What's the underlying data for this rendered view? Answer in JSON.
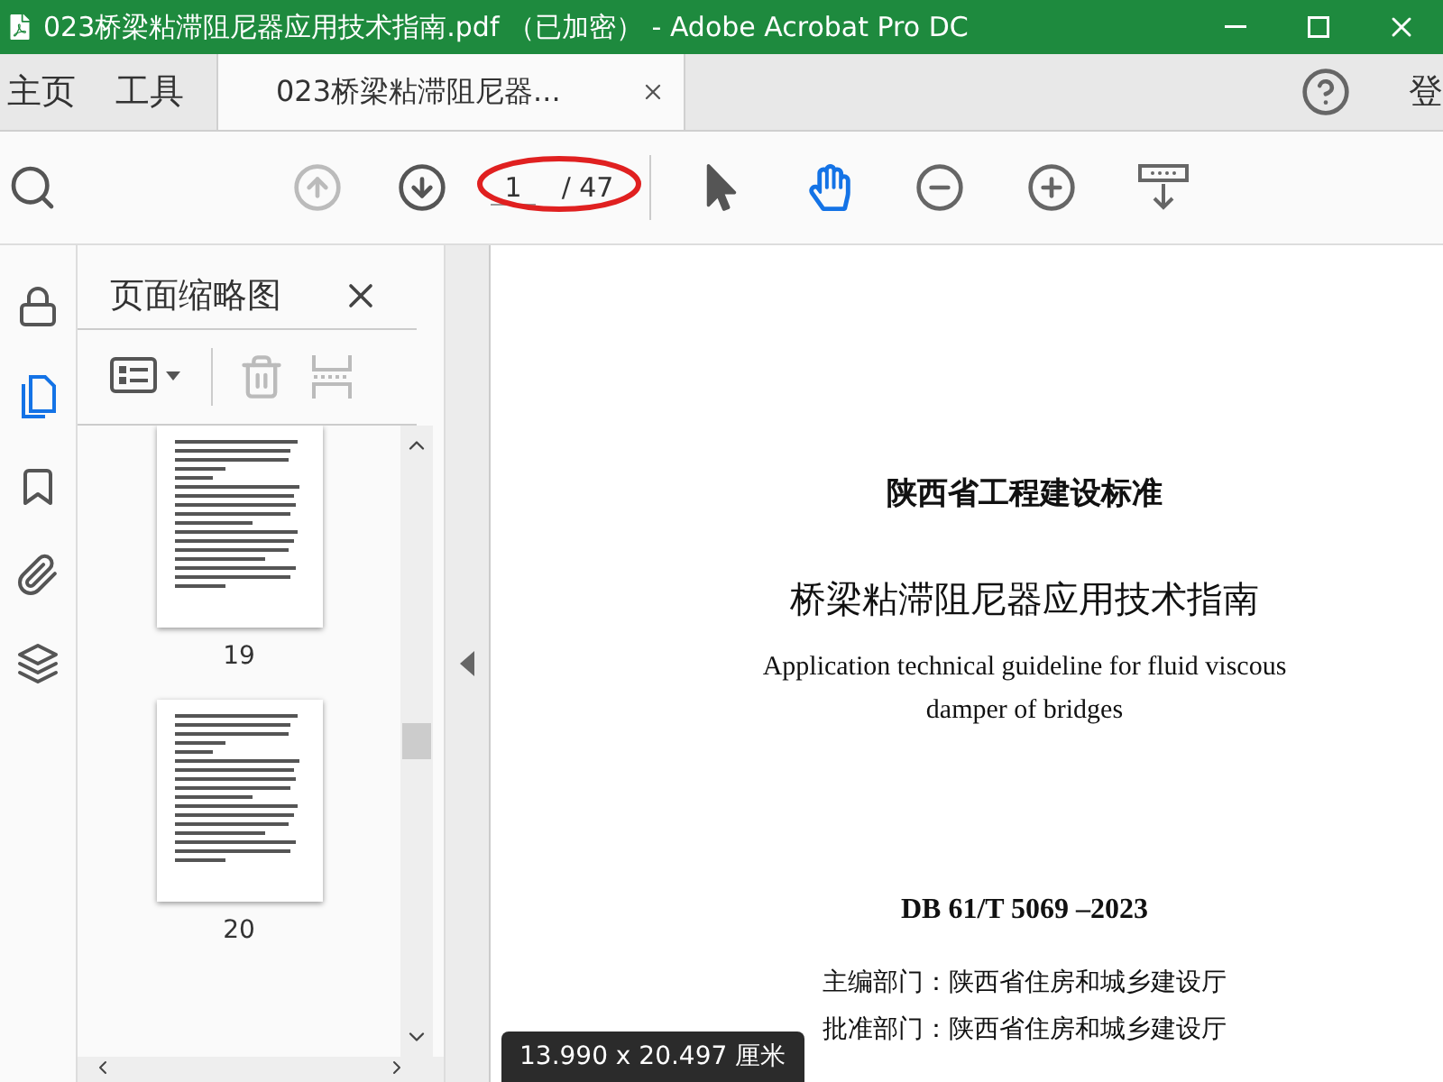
{
  "window": {
    "title": "023桥梁粘滞阻尼器应用技术指南.pdf （已加密） - Adobe Acrobat Pro DC"
  },
  "tabs": [
    {
      "label": "主页",
      "selected": false
    },
    {
      "label": "工具",
      "selected": false
    },
    {
      "label": "023桥梁粘滞阻尼器...",
      "selected": true
    }
  ],
  "header_right": {
    "sign_in": "登"
  },
  "toolbar": {
    "nav": [
      {
        "kind": "prev",
        "disabled": true
      },
      {
        "kind": "next",
        "disabled": false
      }
    ],
    "page_current": "1",
    "page_total": "/ 47",
    "tools": [
      {
        "kind": "select",
        "selected": false
      },
      {
        "kind": "hand",
        "selected": true
      }
    ]
  },
  "rail": [
    {
      "kind": "lock",
      "selected": false
    },
    {
      "kind": "pages",
      "selected": true
    },
    {
      "kind": "bookmark",
      "selected": false
    },
    {
      "kind": "attachment",
      "selected": false
    },
    {
      "kind": "layers",
      "selected": false
    }
  ],
  "thumbnail_panel": {
    "title": "页面缩略图",
    "pages": [
      {
        "label": "19"
      },
      {
        "label": "20"
      }
    ]
  },
  "document": {
    "lines": [
      {
        "kind": "heading",
        "text": "陕西省工程建设标准"
      },
      {
        "kind": "title",
        "text": "桥梁粘滞阻尼器应用技术指南"
      },
      {
        "kind": "english",
        "text": "Application technical guideline for fluid viscous"
      },
      {
        "kind": "english",
        "text": "damper of bridges"
      },
      {
        "kind": "code",
        "text": "DB 61/T  5069 –2023"
      },
      {
        "kind": "dept",
        "text": "主编部门：陕西省住房和城乡建设厅"
      },
      {
        "kind": "dept",
        "text": "批准部门：陕西省住房和城乡建设厅"
      }
    ]
  },
  "status": {
    "page_size": "13.990 x 20.497 厘米"
  }
}
